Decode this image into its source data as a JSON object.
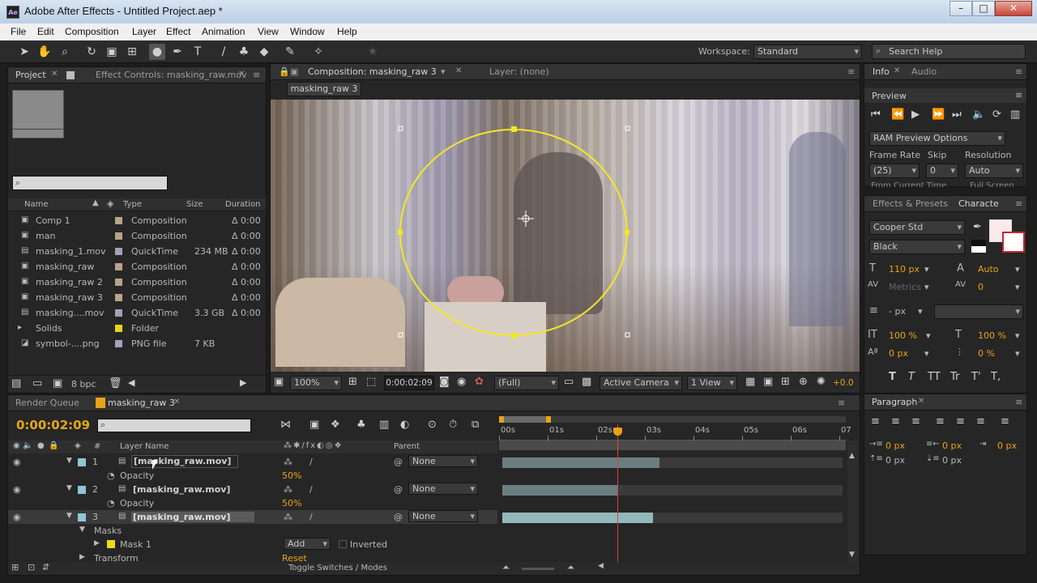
{
  "window": {
    "title": "Adobe After Effects - Untitled Project.aep *",
    "icon": "Ae",
    "minimize": "–",
    "maximize": "□",
    "close": "✕"
  },
  "menu": [
    "File",
    "Edit",
    "Composition",
    "Layer",
    "Effect",
    "Animation",
    "View",
    "Window",
    "Help"
  ],
  "toolbar": {
    "workspace_label": "Workspace:",
    "workspace_value": "Standard",
    "search_placeholder": "Search Help"
  },
  "project_panel": {
    "tab_project": "Project",
    "tab_effect_controls": "Effect Controls: masking_raw.mov",
    "columns": {
      "name": "Name",
      "type": "Type",
      "size": "Size",
      "duration": "Duration"
    },
    "items": [
      {
        "name": "Comp 1",
        "type": "Composition",
        "size": "",
        "duration": "Δ 0:00",
        "color": "#b8a48a",
        "icon": "comp"
      },
      {
        "name": "man",
        "type": "Composition",
        "size": "",
        "duration": "Δ 0:00",
        "color": "#b8a48a",
        "icon": "comp"
      },
      {
        "name": "masking_1.mov",
        "type": "QuickTime",
        "size": "234 MB",
        "duration": "Δ 0:00",
        "color": "#9fa2b8",
        "icon": "footage"
      },
      {
        "name": "masking_raw",
        "type": "Composition",
        "size": "",
        "duration": "Δ 0:00",
        "color": "#b8a48a",
        "icon": "comp"
      },
      {
        "name": "masking_raw 2",
        "type": "Composition",
        "size": "",
        "duration": "Δ 0:00",
        "color": "#b8a48a",
        "icon": "comp"
      },
      {
        "name": "masking_raw 3",
        "type": "Composition",
        "size": "",
        "duration": "Δ 0:00",
        "color": "#b8a48a",
        "icon": "comp"
      },
      {
        "name": "masking....mov",
        "type": "QuickTime",
        "size": "3.3 GB",
        "duration": "Δ 0:00",
        "color": "#9fa2b8",
        "icon": "footage"
      },
      {
        "name": "Solids",
        "type": "Folder",
        "size": "",
        "duration": "",
        "color": "#e6d21e",
        "icon": "folder"
      },
      {
        "name": "symbol-....png",
        "type": "PNG file",
        "size": "7 KB",
        "duration": "",
        "color": "#9fa2b8",
        "icon": "image"
      }
    ],
    "bpc": "8 bpc"
  },
  "composition_panel": {
    "tab_composition": "Composition: masking_raw 3",
    "tab_layer": "Layer: (none)",
    "subtab": "masking_raw 3",
    "zoom": "100%",
    "timecode": "0:00:02:09",
    "resolution": "(Full)",
    "camera": "Active Camera",
    "view": "1 View",
    "exposure": "+0.0"
  },
  "right_panel": {
    "tab_info": "Info",
    "tab_audio": "Audio",
    "preview_title": "Preview",
    "ram_preview": "RAM Preview Options",
    "frame_rate_label": "Frame Rate",
    "skip_label": "Skip",
    "resolution_label": "Resolution",
    "frame_rate": "(25)",
    "skip": "0",
    "resolution": "Auto",
    "from_current": "From Current Time",
    "full_screen": "Full Screen",
    "tab_effects": "Effects & Presets",
    "tab_character": "Characte",
    "font": "Cooper Std",
    "font_style": "Black",
    "font_size": "110 px",
    "leading": "Auto",
    "kerning": "Metrics",
    "tracking": "0",
    "stroke": "- px",
    "vscale": "100 %",
    "hscale": "100 %",
    "baseline": "0 px",
    "tsume": "0 %",
    "type_buttons": [
      "T",
      "T",
      "TT",
      "Tr",
      "T'",
      "T,"
    ],
    "paragraph_title": "Paragraph",
    "indent_left": "0 px",
    "indent_right": "0 px",
    "indent_first": "0 px",
    "space_before": "0 px",
    "space_after": "0 px"
  },
  "timeline": {
    "tab_render": "Render Queue",
    "tab_comp": "masking_raw 3",
    "timecode": "0:00:02:09",
    "col_layer_name": "Layer Name",
    "col_number": "#",
    "col_parent": "Parent",
    "ruler": [
      "00s",
      "01s",
      "02s",
      "03s",
      "04s",
      "05s",
      "06s",
      "07"
    ],
    "layers": [
      {
        "num": "1",
        "name": "[masking_raw.mov]",
        "parent": "None",
        "prop": "Opacity",
        "value": "50%"
      },
      {
        "num": "2",
        "name": "[masking_raw.mov]",
        "parent": "None",
        "prop": "Opacity",
        "value": "50%"
      },
      {
        "num": "3",
        "name": "[masking_raw.mov]",
        "parent": "None"
      }
    ],
    "masks_label": "Masks",
    "mask_name": "Mask 1",
    "mask_mode": "Add",
    "inverted_label": "Inverted",
    "transform_label": "Transform",
    "reset_label": "Reset",
    "toggle_label": "Toggle Switches / Modes"
  }
}
